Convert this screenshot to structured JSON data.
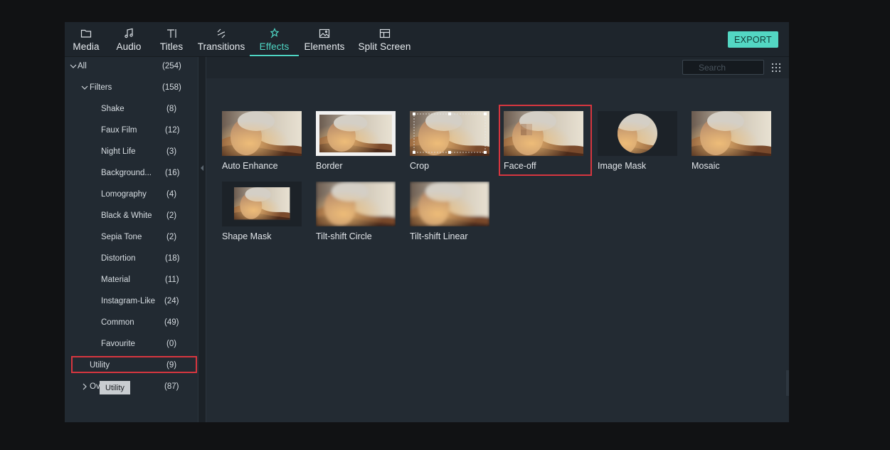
{
  "toolbar": {
    "tabs": [
      {
        "label": "Media",
        "icon": "folder-icon"
      },
      {
        "label": "Audio",
        "icon": "music-note-icon"
      },
      {
        "label": "Titles",
        "icon": "text-icon"
      },
      {
        "label": "Transitions",
        "icon": "transition-icon"
      },
      {
        "label": "Effects",
        "icon": "effects-sparkle-icon",
        "active": true
      },
      {
        "label": "Elements",
        "icon": "image-icon"
      },
      {
        "label": "Split Screen",
        "icon": "split-screen-icon"
      }
    ],
    "export_label": "EXPORT"
  },
  "colors": {
    "accent": "#53d7c3",
    "highlight": "#d7363f",
    "panel": "#232b33"
  },
  "sidebar": {
    "items": [
      {
        "label": "All",
        "count": "(254)",
        "level": 0,
        "expanded": true
      },
      {
        "label": "Filters",
        "count": "(158)",
        "level": 1,
        "expanded": true
      },
      {
        "label": "Shake",
        "count": "(8)",
        "level": 2
      },
      {
        "label": "Faux Film",
        "count": "(12)",
        "level": 2
      },
      {
        "label": "Night Life",
        "count": "(3)",
        "level": 2
      },
      {
        "label": "Background...",
        "count": "(16)",
        "level": 2
      },
      {
        "label": "Lomography",
        "count": "(4)",
        "level": 2
      },
      {
        "label": "Black & White",
        "count": "(2)",
        "level": 2
      },
      {
        "label": "Sepia Tone",
        "count": "(2)",
        "level": 2
      },
      {
        "label": "Distortion",
        "count": "(18)",
        "level": 2
      },
      {
        "label": "Material",
        "count": "(11)",
        "level": 2
      },
      {
        "label": "Instagram-Like",
        "count": "(24)",
        "level": 2
      },
      {
        "label": "Common",
        "count": "(49)",
        "level": 2
      },
      {
        "label": "Favourite",
        "count": "(0)",
        "level": 2
      },
      {
        "label": "Utility",
        "count": "(9)",
        "level": 1,
        "selected": true
      },
      {
        "label": "Ov",
        "count": "(87)",
        "level": 1,
        "expanded": false
      }
    ],
    "tooltip": "Utility"
  },
  "search": {
    "placeholder": "Search",
    "value": ""
  },
  "effects": [
    {
      "label": "Auto Enhance",
      "style": "plain"
    },
    {
      "label": "Border",
      "style": "border"
    },
    {
      "label": "Crop",
      "style": "crop"
    },
    {
      "label": "Face-off",
      "style": "faceoff",
      "selected": true
    },
    {
      "label": "Image Mask",
      "style": "circle"
    },
    {
      "label": "Mosaic",
      "style": "plain"
    },
    {
      "label": "Shape Mask",
      "style": "shape"
    },
    {
      "label": "Tilt-shift Circle",
      "style": "blur"
    },
    {
      "label": "Tilt-shift Linear",
      "style": "blur"
    }
  ]
}
